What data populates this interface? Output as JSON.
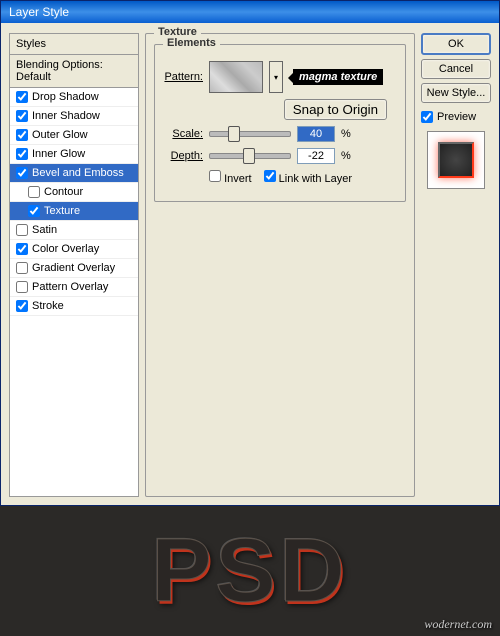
{
  "dialog": {
    "title": "Layer Style"
  },
  "stylesPanel": {
    "header": "Styles",
    "blendingOptions": "Blending Options: Default",
    "items": [
      {
        "label": "Drop Shadow",
        "checked": true,
        "selected": false,
        "sub": false
      },
      {
        "label": "Inner Shadow",
        "checked": true,
        "selected": false,
        "sub": false
      },
      {
        "label": "Outer Glow",
        "checked": true,
        "selected": false,
        "sub": false
      },
      {
        "label": "Inner Glow",
        "checked": true,
        "selected": false,
        "sub": false
      },
      {
        "label": "Bevel and Emboss",
        "checked": true,
        "selected": true,
        "sub": false
      },
      {
        "label": "Contour",
        "checked": false,
        "selected": false,
        "sub": true
      },
      {
        "label": "Texture",
        "checked": true,
        "selected": true,
        "sub": true
      },
      {
        "label": "Satin",
        "checked": false,
        "selected": false,
        "sub": false
      },
      {
        "label": "Color Overlay",
        "checked": true,
        "selected": false,
        "sub": false
      },
      {
        "label": "Gradient Overlay",
        "checked": false,
        "selected": false,
        "sub": false
      },
      {
        "label": "Pattern Overlay",
        "checked": false,
        "selected": false,
        "sub": false
      },
      {
        "label": "Stroke",
        "checked": true,
        "selected": false,
        "sub": false
      }
    ]
  },
  "texturePanel": {
    "title": "Texture",
    "elements": "Elements",
    "patternLabel": "Pattern:",
    "callout": "magma texture",
    "snapBtn": "Snap to Origin",
    "scaleLabel": "Scale:",
    "scaleValue": "40",
    "scalePct": "%",
    "depthLabel": "Depth:",
    "depthValue": "-22",
    "depthPct": "%",
    "invertLabel": "Invert",
    "invertChecked": false,
    "linkLabel": "Link with Layer",
    "linkChecked": true
  },
  "buttons": {
    "ok": "OK",
    "cancel": "Cancel",
    "newStyle": "New Style...",
    "previewLabel": "Preview",
    "previewChecked": true
  },
  "result": {
    "text": "PSD",
    "watermark": "wodernet.com"
  }
}
